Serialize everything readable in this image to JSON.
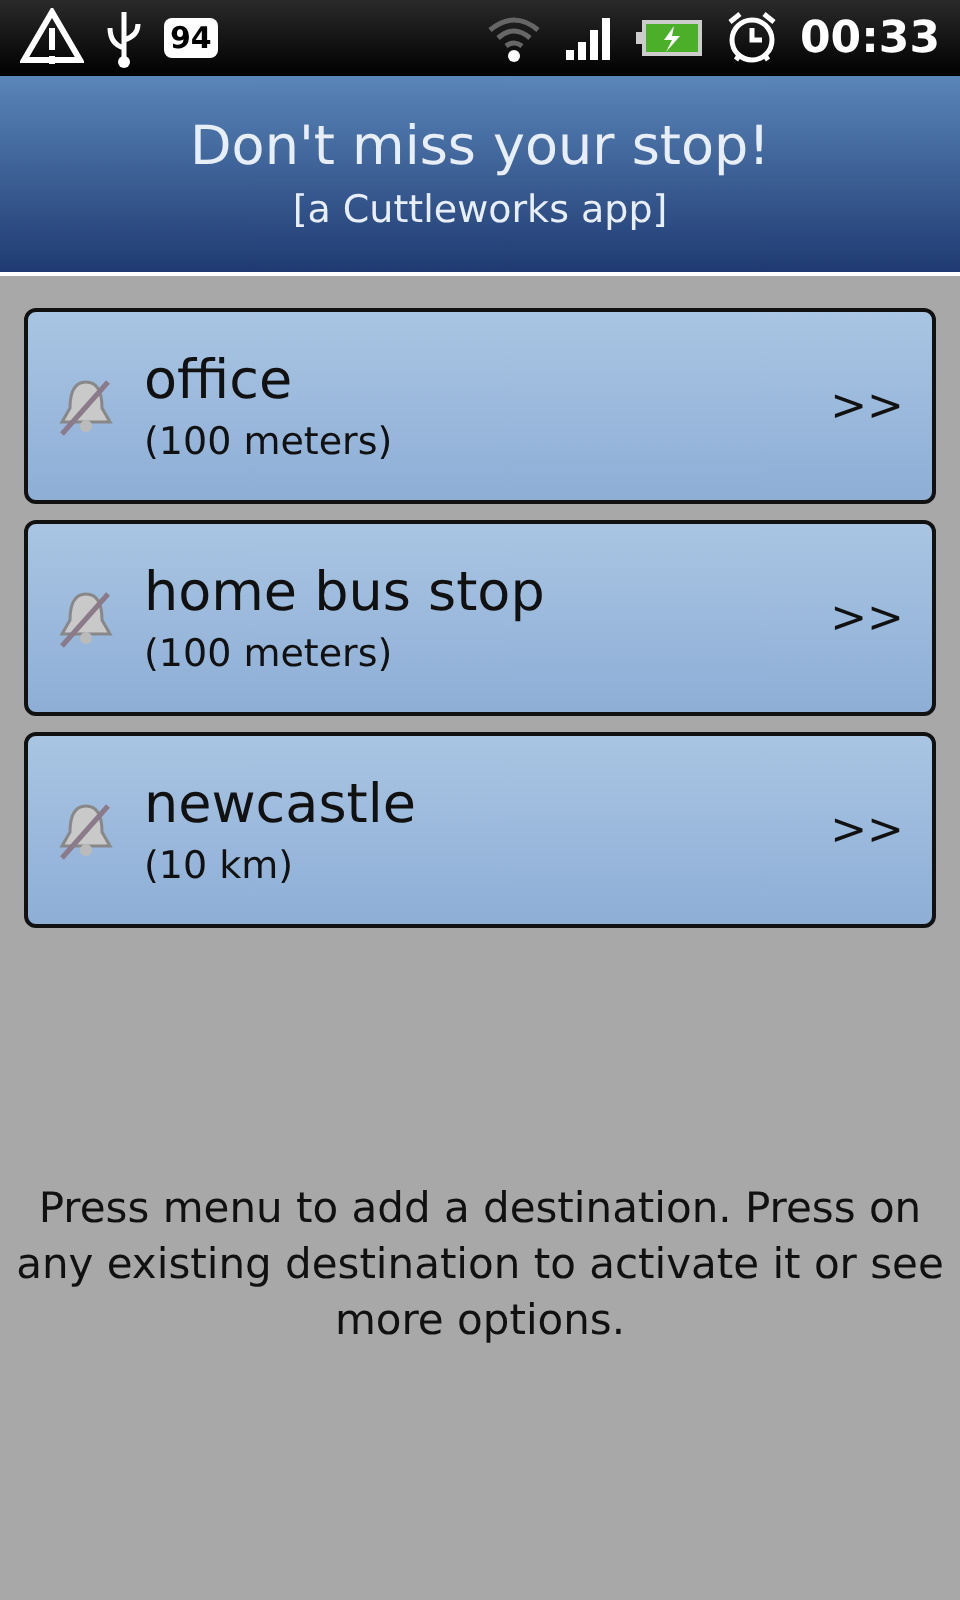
{
  "status_bar": {
    "battery_badge": "94",
    "time": "00:33"
  },
  "header": {
    "title": "Don't miss your stop!",
    "subtitle": "[a Cuttleworks app]"
  },
  "destinations": [
    {
      "name": "office",
      "distance": "(100 meters)",
      "active": false,
      "arrow": ">>"
    },
    {
      "name": "home bus stop",
      "distance": "(100 meters)",
      "active": false,
      "arrow": ">>"
    },
    {
      "name": "newcastle",
      "distance": "(10 km)",
      "active": false,
      "arrow": ">>"
    }
  ],
  "help_text": "Press menu to add a destination. Press on any existing destination to activate it or see more options."
}
